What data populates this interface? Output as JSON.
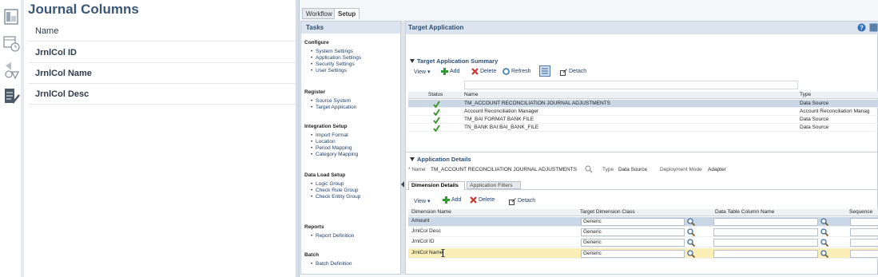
{
  "journal": {
    "title": "Journal Columns",
    "header": "Name",
    "rows": [
      "JrnlCol ID",
      "JrnlCol Name",
      "JrnlCol Desc"
    ]
  },
  "tabs": [
    "Workflow",
    "Setup"
  ],
  "tasks": {
    "header": "Tasks",
    "groups": [
      {
        "title": "Configure",
        "items": [
          "System Settings",
          "Application Settings",
          "Security Settings",
          "User Settings"
        ]
      },
      {
        "title": "Register",
        "items": [
          "Source System",
          "Target Application"
        ]
      },
      {
        "title": "Integration Setup",
        "items": [
          "Import Format",
          "Location",
          "Period Mapping",
          "Category Mapping"
        ]
      },
      {
        "title": "Data Load Setup",
        "items": [
          "Logic Group",
          "Check Rule Group",
          "Check Entity Group"
        ]
      },
      {
        "title": "Reports",
        "items": [
          "Report Definition"
        ]
      },
      {
        "title": "Batch",
        "items": [
          "Batch Definition"
        ]
      }
    ]
  },
  "main": {
    "header": "Target Application",
    "summary": {
      "title": "Target Application Summary",
      "toolbar": {
        "view": "View ▾",
        "add": "Add",
        "delete": "Delete",
        "refresh": "Refresh",
        "detach": "Detach"
      },
      "columns": [
        "Status",
        "Name",
        "Type"
      ],
      "rows": [
        {
          "name": "TM_ACCOUNT RECONCILIATION JOURNAL ADJUSTMENTS",
          "type": "Data Source"
        },
        {
          "name": "Account Reconciliation Manager",
          "type": "Account Reconciliation Manag"
        },
        {
          "name": "TM_BAI FORMAT BANK FILE",
          "type": "Data Source"
        },
        {
          "name": "TN_BANK BAI:BAI_BANK_FILE",
          "type": "Data Source"
        }
      ]
    },
    "details": {
      "title": "Application Details",
      "name_label": "* Name",
      "name_value": "TM_ACCOUNT RECONCILIATION JOURNAL ADJUSTMENTS",
      "type_label": "Type",
      "type_value": "Data Source",
      "mode_label": "Deployment Mode",
      "mode_value": "Adapter"
    },
    "dimension": {
      "tabs": [
        "Dimension Details",
        "Application Filters"
      ],
      "toolbar": {
        "view": "View ▾",
        "add": "Add",
        "delete": "Delete",
        "detach": "Detach"
      },
      "columns": [
        "Dimension Name",
        "Target Dimension Class",
        "Data Table Column Name",
        "Sequence"
      ],
      "rows": [
        {
          "name": "Amount",
          "class": "Generic",
          "column": ""
        },
        {
          "name": "JrnlCol Desc",
          "class": "Generic",
          "column": ""
        },
        {
          "name": "JrnlCol ID",
          "class": "Generic",
          "column": ""
        },
        {
          "name": "JrnlCol Name",
          "class": "Generic",
          "column": ""
        }
      ]
    }
  },
  "colors": {
    "accent": "#2b4d73",
    "selected": "#c9d7e6",
    "highlight": "#fbeeb7",
    "check": "#3c9a2e"
  }
}
